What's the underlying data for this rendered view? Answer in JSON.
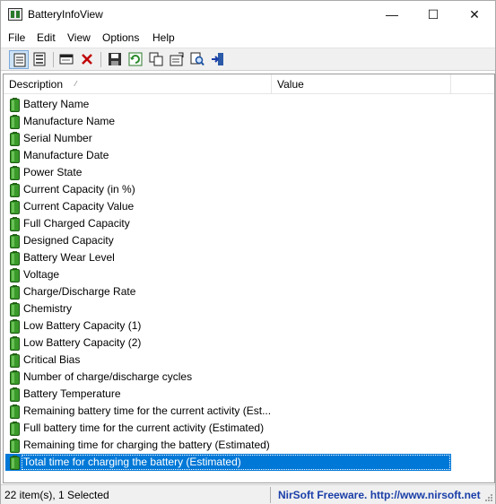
{
  "window": {
    "title": "BatteryInfoView",
    "minimize_glyph": "—",
    "maximize_glyph": "☐",
    "close_glyph": "✕"
  },
  "menu": {
    "items": [
      {
        "label": "File"
      },
      {
        "label": "Edit"
      },
      {
        "label": "View"
      },
      {
        "label": "Options"
      },
      {
        "label": "Help"
      }
    ]
  },
  "toolbar": {
    "buttons": [
      {
        "name": "battery-information-view-icon",
        "active": true
      },
      {
        "name": "battery-log-view-icon",
        "active": false
      },
      {
        "name": "properties-window-icon",
        "active": false
      },
      {
        "name": "delete-icon",
        "active": false
      },
      {
        "name": "save-icon",
        "active": false
      },
      {
        "name": "refresh-icon",
        "active": false
      },
      {
        "name": "copy-icon",
        "active": false
      },
      {
        "name": "properties-icon",
        "active": false
      },
      {
        "name": "find-icon",
        "active": false
      },
      {
        "name": "exit-icon",
        "active": false
      }
    ]
  },
  "list": {
    "columns": {
      "description": "Description",
      "value": "Value",
      "sort_indicator": "⁄"
    },
    "rows": [
      {
        "label": "Battery Name",
        "value": ""
      },
      {
        "label": "Manufacture Name",
        "value": ""
      },
      {
        "label": "Serial Number",
        "value": ""
      },
      {
        "label": "Manufacture Date",
        "value": ""
      },
      {
        "label": "Power State",
        "value": ""
      },
      {
        "label": "Current Capacity (in %)",
        "value": ""
      },
      {
        "label": "Current Capacity Value",
        "value": ""
      },
      {
        "label": "Full Charged Capacity",
        "value": ""
      },
      {
        "label": "Designed Capacity",
        "value": ""
      },
      {
        "label": "Battery Wear Level",
        "value": ""
      },
      {
        "label": "Voltage",
        "value": ""
      },
      {
        "label": "Charge/Discharge Rate",
        "value": ""
      },
      {
        "label": "Chemistry",
        "value": ""
      },
      {
        "label": "Low Battery Capacity (1)",
        "value": ""
      },
      {
        "label": "Low Battery Capacity (2)",
        "value": ""
      },
      {
        "label": "Critical Bias",
        "value": ""
      },
      {
        "label": "Number of charge/discharge cycles",
        "value": ""
      },
      {
        "label": "Battery Temperature",
        "value": ""
      },
      {
        "label": "Remaining battery time for the current activity (Est...",
        "value": ""
      },
      {
        "label": "Full battery time for the current activity (Estimated)",
        "value": ""
      },
      {
        "label": "Remaining time for charging the battery (Estimated)",
        "value": ""
      },
      {
        "label": "Total  time for charging the battery (Estimated)",
        "value": "",
        "selected": true
      }
    ]
  },
  "status": {
    "count_text": "22 item(s), 1 Selected",
    "credit_text": "NirSoft Freeware.  http://www.nirsoft.net"
  },
  "colors": {
    "selection": "#0078d7",
    "battery_green": "#3a9a2a",
    "credit_link": "#1a3ea8"
  }
}
